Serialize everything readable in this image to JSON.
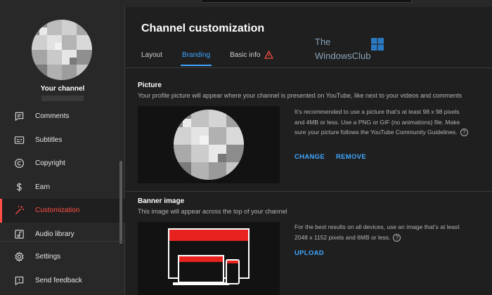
{
  "sidebar": {
    "channel_label": "Your channel",
    "items": [
      {
        "label": "Comments",
        "icon": "comments-icon"
      },
      {
        "label": "Subtitles",
        "icon": "subtitles-icon"
      },
      {
        "label": "Copyright",
        "icon": "copyright-icon"
      },
      {
        "label": "Earn",
        "icon": "dollar-icon"
      },
      {
        "label": "Customization",
        "icon": "magic-wand-icon",
        "active": true
      },
      {
        "label": "Audio library",
        "icon": "audio-library-icon"
      }
    ],
    "bottom_items": [
      {
        "label": "Settings",
        "icon": "gear-icon"
      },
      {
        "label": "Send feedback",
        "icon": "feedback-icon"
      }
    ]
  },
  "main": {
    "title": "Channel customization",
    "tabs": [
      {
        "label": "Layout"
      },
      {
        "label": "Branding",
        "active": true
      },
      {
        "label": "Basic info",
        "warning": true
      }
    ],
    "watermark": {
      "line1": "The",
      "line2": "WindowsClub"
    },
    "picture": {
      "title": "Picture",
      "description": "Your profile picture will appear where your channel is presented on YouTube, like next to your videos and comments",
      "info": "It’s recommended to use a picture that’s at least 98 x 98 pixels and 4MB or less. Use a PNG or GIF (no animations) file. Make sure your picture follows the YouTube Community Guidelines.",
      "change_label": "CHANGE",
      "remove_label": "REMOVE"
    },
    "banner": {
      "title": "Banner image",
      "description": "This image will appear across the top of your channel",
      "info": "For the best results on all devices, use an image that’s at least 2048 x 1152 pixels and 6MB or less.",
      "upload_label": "UPLOAD"
    }
  },
  "colors": {
    "accent_blue": "#3ea6ff",
    "active_red": "#ff4e45",
    "background": "#1f1f1f",
    "sidebar": "#282828"
  }
}
